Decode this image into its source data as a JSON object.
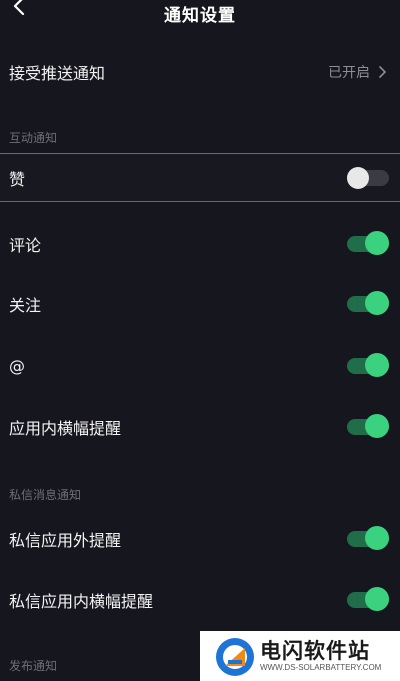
{
  "header": {
    "title": "通知设置"
  },
  "push": {
    "label": "接受推送通知",
    "value": "已开启"
  },
  "sections": {
    "interaction": "互动通知",
    "private_message": "私信消息通知",
    "publish": "发布通知"
  },
  "settings": [
    {
      "label": "赞",
      "on": false
    },
    {
      "label": "评论",
      "on": true
    },
    {
      "label": "关注",
      "on": true
    },
    {
      "label": "@",
      "on": true
    },
    {
      "label": "应用内横幅提醒",
      "on": true
    },
    {
      "label": "私信应用外提醒",
      "on": true
    },
    {
      "label": "私信应用内横幅提醒",
      "on": true
    }
  ],
  "watermark": {
    "title": "电闪软件站",
    "subtitle": "WWW.DS-SOLARBATTERY.COM"
  },
  "colors": {
    "background": "#16161f",
    "toggle_on": "#3ad27f",
    "highlight_border": "#b4541e"
  }
}
